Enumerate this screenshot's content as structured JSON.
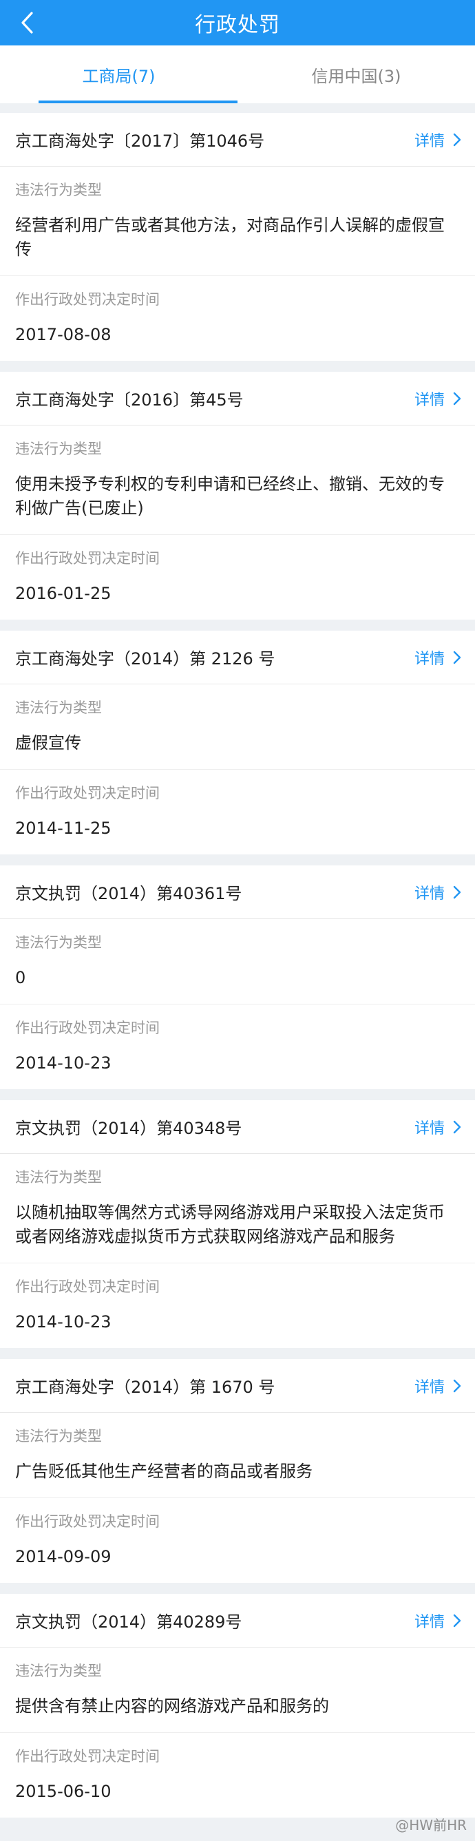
{
  "header": {
    "title": "行政处罚"
  },
  "tabs": [
    {
      "label": "工商局(7)",
      "active": true
    },
    {
      "label": "信用中国(3)",
      "active": false
    }
  ],
  "field_labels": {
    "type": "违法行为类型",
    "date": "作出行政处罚决定时间"
  },
  "detail_label": "详情",
  "records": [
    {
      "number": "京工商海处字〔2017〕第1046号",
      "type": "经营者利用广告或者其他方法，对商品作引人误解的虚假宣传",
      "date": "2017-08-08"
    },
    {
      "number": "京工商海处字〔2016〕第45号",
      "type": "使用未授予专利权的专利申请和已经终止、撤销、无效的专利做广告(已废止)",
      "date": "2016-01-25"
    },
    {
      "number": "京工商海处字（2014）第 2126 号",
      "type": "虚假宣传",
      "date": "2014-11-25"
    },
    {
      "number": "京文执罚（2014）第40361号",
      "type": "0",
      "date": "2014-10-23"
    },
    {
      "number": "京文执罚（2014）第40348号",
      "type": "以随机抽取等偶然方式诱导网络游戏用户采取投入法定货币或者网络游戏虚拟货币方式获取网络游戏产品和服务",
      "date": "2014-10-23"
    },
    {
      "number": "京工商海处字（2014）第 1670 号",
      "type": "广告贬低其他生产经营者的商品或者服务",
      "date": "2014-09-09"
    },
    {
      "number": "京文执罚（2014）第40289号",
      "type": "提供含有禁止内容的网络游戏产品和服务的",
      "date": "2015-06-10"
    }
  ],
  "watermark": "@HW前HR",
  "colors": {
    "primary": "#2196f3",
    "background": "#eef1f4"
  },
  "icons": {
    "back": "chevron-left-icon",
    "detail": "chevron-right-icon"
  }
}
